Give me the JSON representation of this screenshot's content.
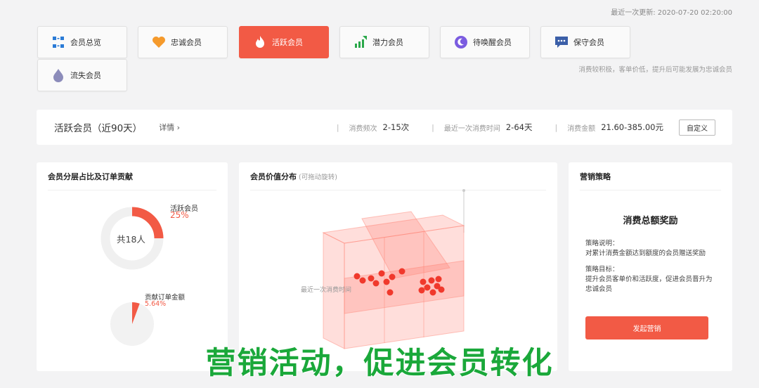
{
  "header": {
    "update_time": "最近一次更新: 2020-07-20 02:20:00"
  },
  "tabs": [
    {
      "label": "会员总览",
      "icon": "grid-icon"
    },
    {
      "label": "忠诚会员",
      "icon": "heart-icon"
    },
    {
      "label": "活跃会员",
      "icon": "flame-icon",
      "active": true
    },
    {
      "label": "潜力会员",
      "icon": "growth-chart-icon"
    },
    {
      "label": "待唤醒会员",
      "icon": "moon-icon"
    },
    {
      "label": "保守会员",
      "icon": "chat-icon"
    },
    {
      "label": "流失会员",
      "icon": "water-drop-icon"
    }
  ],
  "tab_hint": "消费较积极，客单价低，提升后可能发展为忠诚会员",
  "infobar": {
    "title": "活跃会员（近90天）",
    "detail": "详情 ›",
    "freq_label": "消费频次",
    "freq_value": "2-15次",
    "recent_label": "最近一次消费时间",
    "recent_value": "2-64天",
    "amount_label": "消费金额",
    "amount_value": "21.60-385.00元",
    "custom_button": "自定义"
  },
  "panel_left": {
    "title": "会员分层占比及订单贡献",
    "donut_center": "共18人",
    "donut_label": "活跃会员",
    "donut_percent": "25%",
    "donut_fraction": 0.25,
    "pie_label": "贡献订单金额",
    "pie_percent": "5.64%",
    "pie_fraction": 0.0564
  },
  "panel_middle": {
    "title": "会员价值分布",
    "subtitle": "(可拖动旋转)",
    "axis_label": "最近一次消费时间"
  },
  "panel_right": {
    "title": "营销策略",
    "strategy_name": "消费总额奖励",
    "desc_label": "策略说明：",
    "desc_text": "对累计消费金额达到额度的会员赠送奖励",
    "goal_label": "策略目标：",
    "goal_text": "提升会员客单价和活跃度，促进会员晋升为忠诚会员",
    "cta": "发起营销"
  },
  "caption": "营销活动，促进会员转化",
  "colors": {
    "accent": "#f25a45",
    "caption": "#1aa83a"
  }
}
